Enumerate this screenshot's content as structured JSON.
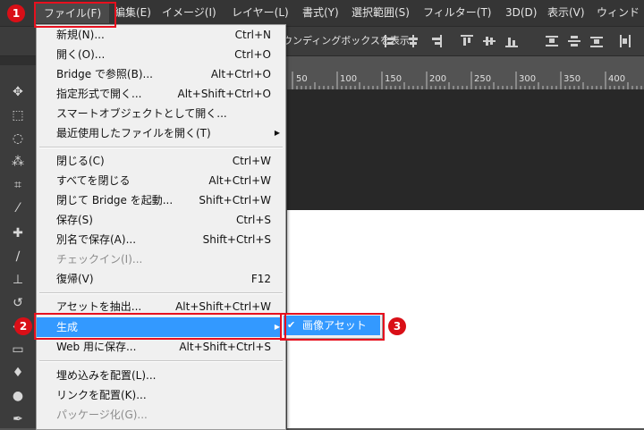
{
  "menubar": {
    "items": [
      "ファイル(F)",
      "編集(E)",
      "イメージ(I)",
      "レイヤー(L)",
      "書式(Y)",
      "選択範囲(S)",
      "フィルター(T)",
      "3D(D)",
      "表示(V)",
      "ウィンド"
    ]
  },
  "options_bar": {
    "bbox_label": "ウンディングボックスを表示"
  },
  "ruler": {
    "ticks": [
      "50",
      "100",
      "150",
      "200",
      "250",
      "300",
      "350",
      "400"
    ]
  },
  "file_menu": {
    "items": [
      {
        "label": "新規(N)...",
        "shortcut": "Ctrl+N"
      },
      {
        "label": "開く(O)...",
        "shortcut": "Ctrl+O"
      },
      {
        "label": "Bridge で参照(B)...",
        "shortcut": "Alt+Ctrl+O"
      },
      {
        "label": "指定形式で開く...",
        "shortcut": "Alt+Shift+Ctrl+O"
      },
      {
        "label": "スマートオブジェクトとして開く...",
        "shortcut": ""
      },
      {
        "label": "最近使用したファイルを開く(T)",
        "shortcut": "",
        "submenu": true
      },
      {
        "label": "閉じる(C)",
        "shortcut": "Ctrl+W"
      },
      {
        "label": "すべてを閉じる",
        "shortcut": "Alt+Ctrl+W"
      },
      {
        "label": "閉じて Bridge を起動...",
        "shortcut": "Shift+Ctrl+W"
      },
      {
        "label": "保存(S)",
        "shortcut": "Ctrl+S"
      },
      {
        "label": "別名で保存(A)...",
        "shortcut": "Shift+Ctrl+S"
      },
      {
        "label": "チェックイン(I)...",
        "shortcut": "",
        "disabled": true
      },
      {
        "label": "復帰(V)",
        "shortcut": "F12"
      },
      {
        "label": "アセットを抽出...",
        "shortcut": "Alt+Shift+Ctrl+W"
      },
      {
        "label": "生成",
        "shortcut": "",
        "submenu": true,
        "highlighted": true
      },
      {
        "label": "Web 用に保存...",
        "shortcut": "Alt+Shift+Ctrl+S"
      },
      {
        "label": "埋め込みを配置(L)...",
        "shortcut": ""
      },
      {
        "label": "リンクを配置(K)...",
        "shortcut": ""
      },
      {
        "label": "パッケージ化(G)...",
        "shortcut": "",
        "disabled": true
      }
    ]
  },
  "submenu": {
    "check": "✔",
    "item_label": "画像アセット"
  },
  "callouts": {
    "one": "1",
    "two": "2",
    "three": "3"
  },
  "colors": {
    "highlight": "#3399ff",
    "callout_red": "#e8101e",
    "menubar_bg": "#353535",
    "canvas_dark": "#282828"
  },
  "tools": [
    "move-icon",
    "marquee-icon",
    "lasso-icon",
    "quick-select-icon",
    "crop-icon",
    "eyedropper-icon",
    "healing-icon",
    "brush-icon",
    "stamp-icon",
    "history-brush-icon",
    "eraser-icon",
    "gradient-icon",
    "blur-icon",
    "dodge-icon",
    "pen-icon"
  ]
}
